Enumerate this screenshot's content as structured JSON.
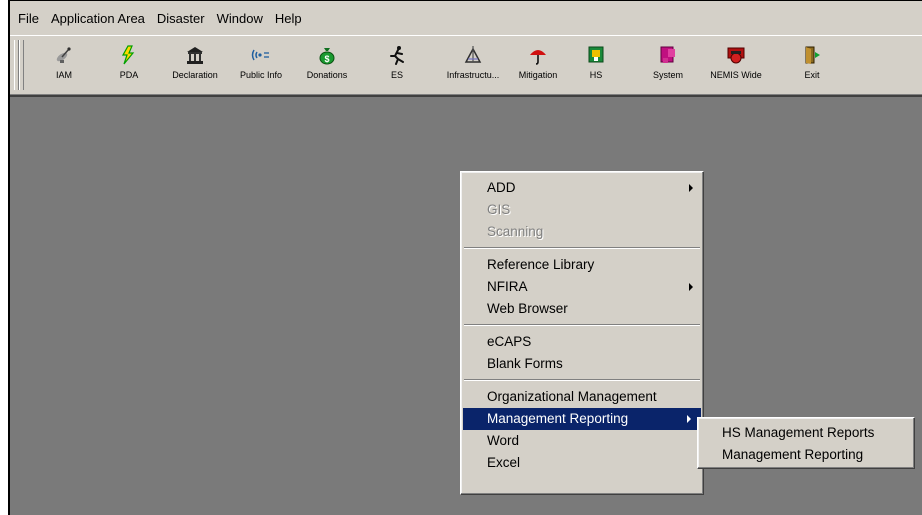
{
  "menubar": [
    "File",
    "Application Area",
    "Disaster",
    "Window",
    "Help"
  ],
  "toolbar": [
    {
      "label": "IAM",
      "icon": "satellite-dish-icon"
    },
    {
      "label": "PDA",
      "icon": "lightning-icon"
    },
    {
      "label": "Declaration",
      "icon": "government-building-icon"
    },
    {
      "label": "Public Info",
      "icon": "broadcast-icon"
    },
    {
      "label": "Donations",
      "icon": "money-bag-icon"
    },
    {
      "label": "ES",
      "icon": "running-person-icon"
    },
    {
      "label": "Infrastructu...",
      "icon": "drafting-tools-icon"
    },
    {
      "label": "Mitigation",
      "icon": "umbrella-icon"
    },
    {
      "label": "HS",
      "icon": "hs-box-icon"
    },
    {
      "label": "System",
      "icon": "system-icon"
    },
    {
      "label": "NEMIS Wide",
      "icon": "nemis-globe-icon"
    },
    {
      "label": "Exit",
      "icon": "exit-door-icon"
    }
  ],
  "context_menu": {
    "groups": [
      [
        {
          "label": "ADD",
          "submenu": true,
          "disabled": false
        },
        {
          "label": "GIS",
          "disabled": true
        },
        {
          "label": "Scanning",
          "disabled": true
        }
      ],
      [
        {
          "label": "Reference Library"
        },
        {
          "label": "NFIRA",
          "submenu": true
        },
        {
          "label": "Web Browser"
        }
      ],
      [
        {
          "label": "eCAPS"
        },
        {
          "label": "Blank Forms"
        }
      ],
      [
        {
          "label": "Organizational Management"
        },
        {
          "label": "Management Reporting",
          "submenu": true,
          "selected": true
        },
        {
          "label": "Word"
        },
        {
          "label": "Excel"
        }
      ]
    ]
  },
  "submenu": [
    "HS Management Reports",
    "Management Reporting"
  ],
  "colors": {
    "menu_face": "#d4d0c8",
    "workspace": "#7a7a7a",
    "selection": "#0a246a",
    "disabled_text": "#808080"
  }
}
